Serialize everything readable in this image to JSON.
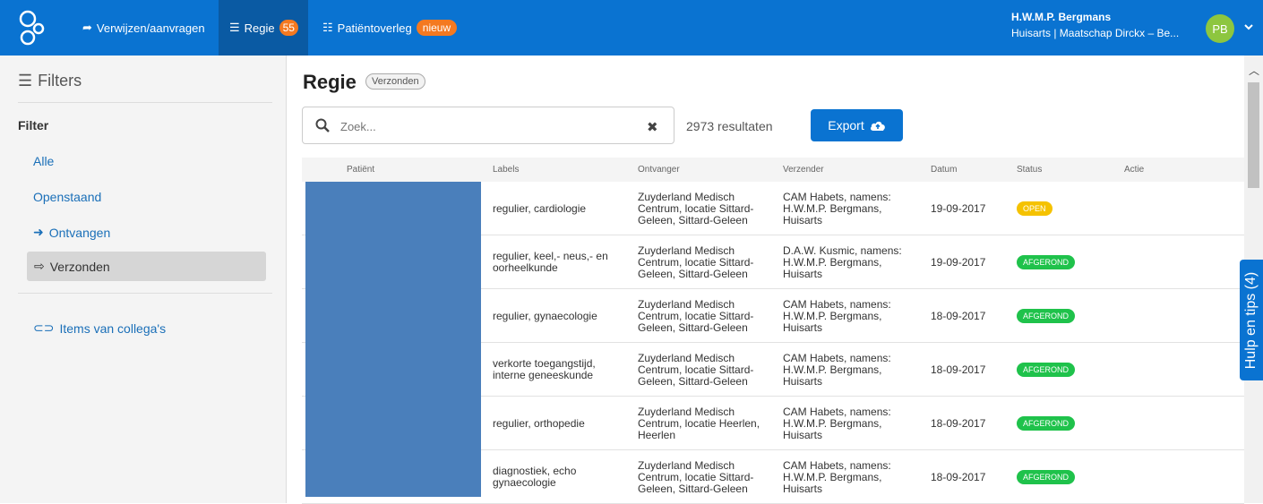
{
  "nav": {
    "logo": "logo-icon",
    "items": [
      {
        "label": "Verwijzen/aanvragen",
        "icon": "share-arrow-icon"
      },
      {
        "label": "Regie",
        "icon": "list-icon",
        "count": "55"
      },
      {
        "label": "Patiëntoverleg",
        "icon": "chat-icon",
        "badge": "nieuw"
      }
    ],
    "user": {
      "name": "H.W.M.P. Bergmans",
      "role": "Huisarts | Maatschap Dirckx – Be...",
      "initials": "PB"
    }
  },
  "sidebar": {
    "header": "Filters",
    "filter_title": "Filter",
    "items": [
      {
        "label": "Alle"
      },
      {
        "label": "Openstaand"
      },
      {
        "label": "Ontvangen",
        "icon": "sign-in-icon"
      },
      {
        "label": "Verzonden",
        "icon": "sign-out-icon",
        "active": true
      }
    ],
    "colleagues": "Items van collega's"
  },
  "main": {
    "title": "Regie",
    "title_badge": "Verzonden",
    "search_placeholder": "Zoek...",
    "result_count": "2973 resultaten",
    "export_label": "Export",
    "columns": [
      "Patiënt",
      "Labels",
      "Ontvanger",
      "Verzender",
      "Datum",
      "Status",
      "Actie"
    ],
    "rows": [
      {
        "labels": [
          "regulier, cardiologie"
        ],
        "ontvanger": [
          "Zuyderland Medisch",
          "Centrum, locatie Sittard-",
          "Geleen, Sittard-Geleen"
        ],
        "verzender": [
          "CAM Habets, namens:",
          "H.W.M.P. Bergmans,",
          "Huisarts"
        ],
        "datum": "19-09-2017",
        "status": "OPEN"
      },
      {
        "labels": [
          "regulier, keel,- neus,- en",
          "oorheelkunde"
        ],
        "ontvanger": [
          "Zuyderland Medisch",
          "Centrum, locatie Sittard-",
          "Geleen, Sittard-Geleen"
        ],
        "verzender": [
          "D.A.W. Kusmic, namens:",
          "H.W.M.P. Bergmans,",
          "Huisarts"
        ],
        "datum": "19-09-2017",
        "status": "AFGEROND"
      },
      {
        "labels": [
          "regulier, gynaecologie"
        ],
        "ontvanger": [
          "Zuyderland Medisch",
          "Centrum, locatie Sittard-",
          "Geleen, Sittard-Geleen"
        ],
        "verzender": [
          "CAM Habets, namens:",
          "H.W.M.P. Bergmans,",
          "Huisarts"
        ],
        "datum": "18-09-2017",
        "status": "AFGEROND"
      },
      {
        "labels": [
          "verkorte toegangstijd,",
          "interne geneeskunde"
        ],
        "ontvanger": [
          "Zuyderland Medisch",
          "Centrum, locatie Sittard-",
          "Geleen, Sittard-Geleen"
        ],
        "verzender": [
          "CAM Habets, namens:",
          "H.W.M.P. Bergmans,",
          "Huisarts"
        ],
        "datum": "18-09-2017",
        "status": "AFGEROND"
      },
      {
        "labels": [
          "regulier, orthopedie"
        ],
        "ontvanger": [
          "Zuyderland Medisch",
          "Centrum, locatie Heerlen,",
          "Heerlen"
        ],
        "verzender": [
          "CAM Habets, namens:",
          "H.W.M.P. Bergmans,",
          "Huisarts"
        ],
        "datum": "18-09-2017",
        "status": "AFGEROND"
      },
      {
        "labels": [
          "diagnostiek, echo",
          "gynaecologie"
        ],
        "ontvanger": [
          "Zuyderland Medisch",
          "Centrum, locatie Sittard-",
          "Geleen, Sittard-Geleen"
        ],
        "verzender": [
          "CAM Habets, namens:",
          "H.W.M.P. Bergmans,",
          "Huisarts"
        ],
        "datum": "18-09-2017",
        "status": "AFGEROND"
      }
    ]
  },
  "help_tab": "Hulp en tips (4)",
  "colors": {
    "primary": "#0a73d1",
    "active_nav": "#0a5aa3",
    "orange_badge": "#f47920",
    "status_open": "#f5c200",
    "status_done": "#1fc24b",
    "avatar": "#8dc63f"
  }
}
